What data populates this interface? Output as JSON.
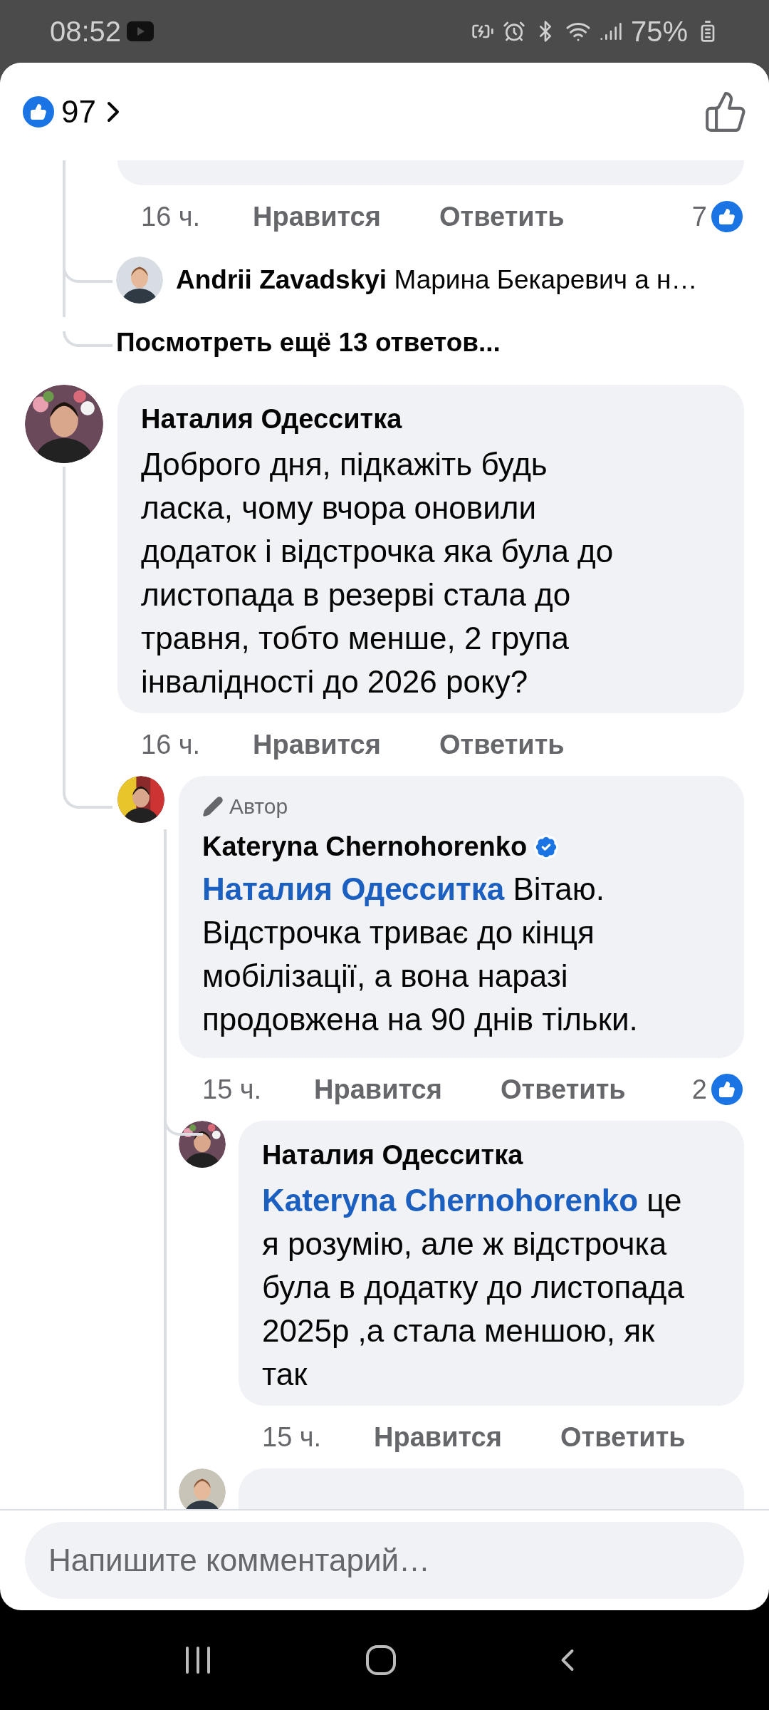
{
  "status_bar": {
    "time": "08:52",
    "battery": "75%"
  },
  "header": {
    "reaction_count": "97"
  },
  "first_thread": {
    "actions": {
      "time": "16 ч.",
      "like": "Нравится",
      "reply": "Ответить",
      "reaction_count": "7"
    },
    "reply_preview": {
      "name": "Andrii Zavadskyi",
      "text": "Марина Бекаревич а н…"
    },
    "more_replies": "Посмотреть ещё 13 ответов..."
  },
  "comment": {
    "name": "Наталия Одесситка",
    "text": "Доброго дня, підкажіть будь ласка, чому вчора оновили додаток і відстрочка яка була до листопада в резерві стала до травня, тобто менше, 2 група інвалідності до 2026 року?",
    "actions": {
      "time": "16 ч.",
      "like": "Нравится",
      "reply": "Ответить"
    },
    "reply": {
      "badge": "Автор",
      "name": "Kateryna Chernohorenko",
      "verified": true,
      "mention": "Наталия Одесситка",
      "text": "Вітаю. Відстрочка триває до кінця мобілізації, а вона наразі продовжена на 90 днів тільки.",
      "actions": {
        "time": "15 ч.",
        "like": "Нравится",
        "reply": "Ответить",
        "reaction_count": "2"
      },
      "reply": {
        "name": "Наталия Одесситка",
        "mention": "Kateryna Chernohorenko",
        "text": "це я розумію, але ж відстрочка була в додатку до листопада 2025р ,а стала меншою, як так",
        "actions": {
          "time": "15 ч.",
          "like": "Нравится",
          "reply": "Ответить"
        }
      }
    }
  },
  "comment_box": {
    "placeholder": "Напишите комментарий…"
  }
}
